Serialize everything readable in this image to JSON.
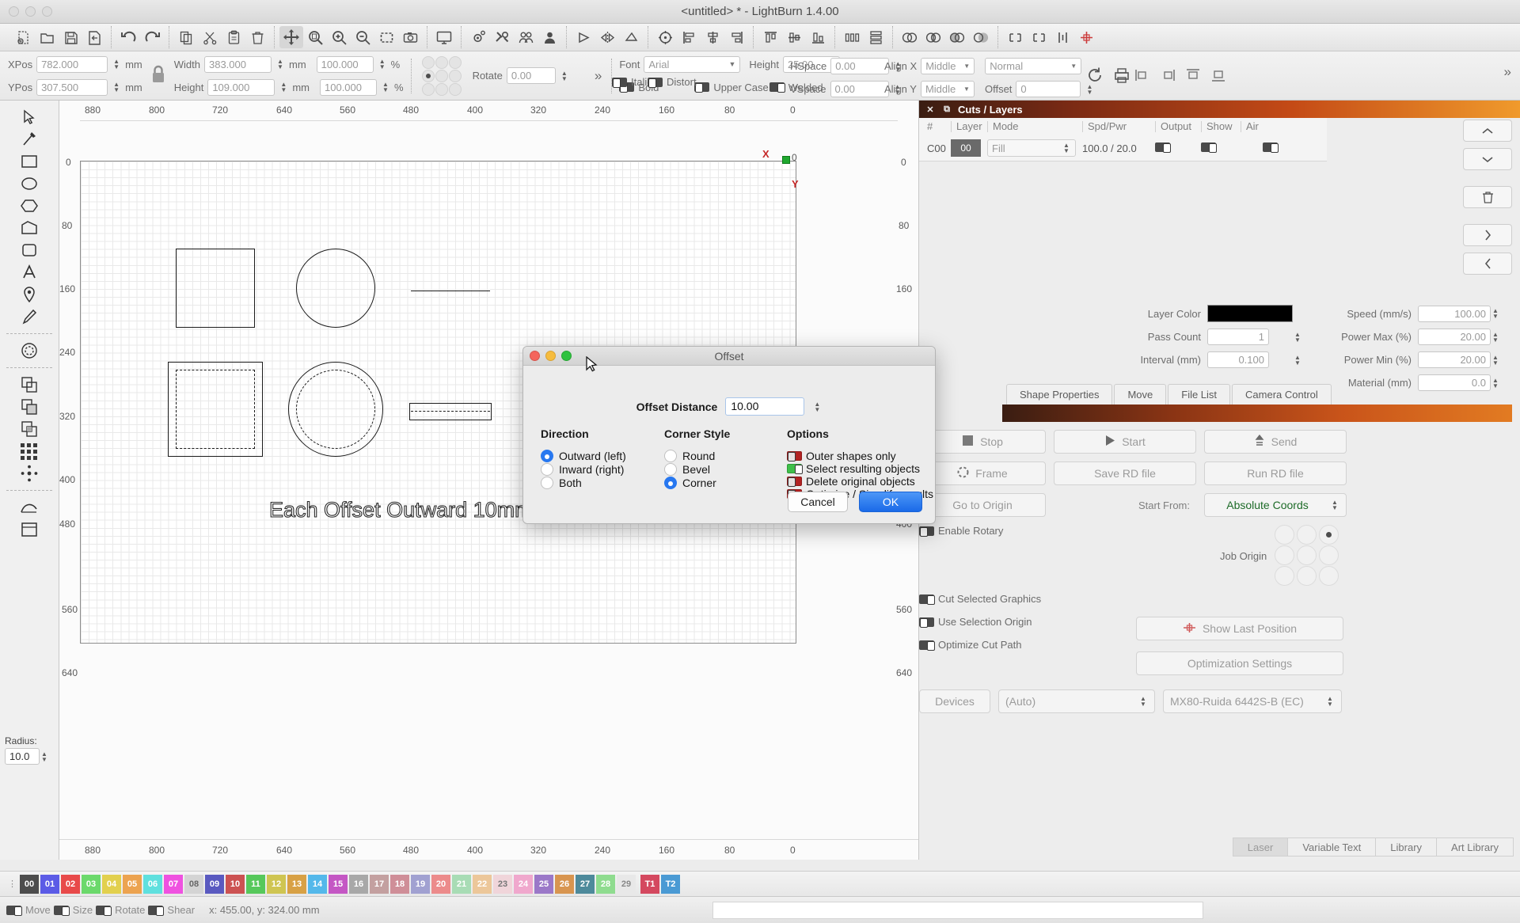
{
  "window": {
    "title": "<untitled> * - LightBurn 1.4.00"
  },
  "toolbar": {
    "groups": [
      {
        "buttons": [
          {
            "name": "new-file",
            "icon": "new-file-icon"
          },
          {
            "name": "open-file",
            "icon": "open-folder-icon"
          },
          {
            "name": "save-file",
            "icon": "save-disk-icon"
          },
          {
            "name": "export-file",
            "icon": "export-icon"
          }
        ]
      },
      {
        "buttons": [
          {
            "name": "undo",
            "icon": "undo-arrow-icon"
          },
          {
            "name": "redo",
            "icon": "redo-arrow-icon"
          }
        ]
      },
      {
        "buttons": [
          {
            "name": "copy",
            "icon": "copy-icon"
          },
          {
            "name": "cut",
            "icon": "scissors-icon"
          },
          {
            "name": "paste",
            "icon": "clipboard-icon"
          },
          {
            "name": "delete",
            "icon": "trash-icon"
          }
        ]
      },
      {
        "buttons": [
          {
            "name": "pan-tool",
            "icon": "move-arrows-icon",
            "selected": true
          },
          {
            "name": "zoom-fit",
            "icon": "zoom-page-icon"
          },
          {
            "name": "zoom-in",
            "icon": "zoom-in-icon"
          },
          {
            "name": "zoom-out",
            "icon": "zoom-out-icon"
          },
          {
            "name": "zoom-selection",
            "icon": "zoom-selection-icon"
          },
          {
            "name": "camera-capture",
            "icon": "camera-icon"
          }
        ]
      },
      {
        "buttons": [
          {
            "name": "preview",
            "icon": "monitor-icon"
          }
        ]
      },
      {
        "buttons": [
          {
            "name": "device-settings",
            "icon": "gear-icon"
          },
          {
            "name": "machine-settings",
            "icon": "wrench-icon"
          },
          {
            "name": "font-manager",
            "icon": "user-group-icon"
          },
          {
            "name": "user-icon",
            "icon": "user-icon"
          }
        ]
      },
      {
        "buttons": [
          {
            "name": "cut-direction",
            "icon": "arrow-right-icon"
          },
          {
            "name": "mirror-horizontal",
            "icon": "mirror-h-icon"
          },
          {
            "name": "mirror-vertical",
            "icon": "mirror-v-icon"
          }
        ]
      },
      {
        "buttons": [
          {
            "name": "rotate-tool",
            "icon": "rotate-icon"
          },
          {
            "name": "align-left",
            "icon": "align-left-icon"
          },
          {
            "name": "align-center-h",
            "icon": "align-center-icon"
          },
          {
            "name": "align-right",
            "icon": "align-right-icon"
          }
        ]
      },
      {
        "buttons": [
          {
            "name": "align-top",
            "icon": "align-top-icon"
          },
          {
            "name": "align-middle",
            "icon": "align-middle-icon"
          },
          {
            "name": "align-bottom",
            "icon": "align-bottom-icon"
          }
        ]
      },
      {
        "buttons": [
          {
            "name": "distribute-h",
            "icon": "distribute-h-icon"
          },
          {
            "name": "distribute-v",
            "icon": "distribute-v-icon"
          }
        ]
      },
      {
        "buttons": [
          {
            "name": "group-objects",
            "icon": "group-icon"
          },
          {
            "name": "ungroup-objects",
            "icon": "ungroup-icon"
          },
          {
            "name": "boolean-union",
            "icon": "union-icon"
          },
          {
            "name": "boolean-subtract",
            "icon": "subtract-icon"
          }
        ]
      },
      {
        "buttons": [
          {
            "name": "weld-shapes",
            "icon": "weld-icon"
          },
          {
            "name": "offset-shapes",
            "icon": "offset-icon"
          },
          {
            "name": "array-tool",
            "icon": "array-icon"
          },
          {
            "name": "center-origin",
            "icon": "crosshair-icon"
          }
        ]
      }
    ]
  },
  "properties": {
    "xpos_label": "XPos",
    "xpos_value": "782.000",
    "ypos_label": "YPos",
    "ypos_value": "307.500",
    "pos_unit": "mm",
    "width_label": "Width",
    "width_value": "383.000",
    "height_label": "Height",
    "height_value": "109.000",
    "size_unit": "mm",
    "width_pct": "100.000",
    "height_pct": "100.000",
    "pct_sign": "%",
    "rotate_label": "Rotate",
    "rotate_value": "0.00",
    "lock_icon": "lock-icon",
    "expand_icon": "chevron-double-right-icon"
  },
  "text_toolbar": {
    "font_label": "Font",
    "font_value": "Arial",
    "height_label": "Height",
    "height_value": "25.00",
    "hspace_label": "HSpace",
    "hspace_value": "0.00",
    "vspace_label": "VSpace",
    "vspace_value": "0.00",
    "alignx_label": "Align X",
    "alignx_value": "Middle",
    "aligny_label": "Align Y",
    "aligny_value": "Middle",
    "normal_value": "Normal",
    "offset_label": "Offset",
    "offset_value": "0",
    "toggles": [
      {
        "label": "Bold",
        "on": false
      },
      {
        "label": "Italic",
        "on": false
      },
      {
        "label": "Upper Case",
        "on": false
      },
      {
        "label": "Distort",
        "on": false
      },
      {
        "label": "Welded",
        "on": false
      }
    ],
    "right_icons": [
      {
        "name": "refresh-icon"
      },
      {
        "name": "print-icon"
      },
      {
        "name": "align-node-left-icon"
      },
      {
        "name": "align-node-right-icon"
      },
      {
        "name": "align-node-top-icon"
      },
      {
        "name": "align-node-bottom-icon"
      },
      {
        "name": "expand-panel-icon"
      }
    ]
  },
  "tools": [
    {
      "name": "select-tool",
      "icon": "arrow-cursor-icon"
    },
    {
      "name": "edit-nodes-tool",
      "icon": "node-edit-icon"
    },
    {
      "name": "rectangle-tool",
      "icon": "square-icon"
    },
    {
      "name": "ellipse-tool",
      "icon": "circle-icon"
    },
    {
      "name": "polygon-tool",
      "icon": "hexagon-icon"
    },
    {
      "name": "draw-lines-tool",
      "icon": "polyline-icon"
    },
    {
      "name": "rounded-rect-tool",
      "icon": "rounded-square-icon"
    },
    {
      "name": "text-tool",
      "icon": "letter-a-icon"
    },
    {
      "name": "position-tool",
      "icon": "map-pin-icon"
    },
    {
      "name": "pen-tool",
      "icon": "pencil-icon"
    },
    {
      "name": "offset-shapes-tool",
      "icon": "offset-ring-icon"
    },
    {
      "name": "boolean-union-tool",
      "icon": "bool-union-icon"
    },
    {
      "name": "boolean-subtract-tool",
      "icon": "bool-subtract-icon"
    },
    {
      "name": "boolean-intersect-tool",
      "icon": "bool-intersect-icon"
    },
    {
      "name": "grid-array-tool",
      "icon": "grid-array-icon"
    },
    {
      "name": "circular-array-tool",
      "icon": "circular-array-icon"
    },
    {
      "name": "trace-image-tool",
      "icon": "trace-curve-icon"
    },
    {
      "name": "print-and-cut-tool",
      "icon": "print-cut-icon"
    }
  ],
  "radius": {
    "label": "Radius:",
    "value": "10.0"
  },
  "canvas": {
    "ruler_top": [
      "880",
      "800",
      "720",
      "640",
      "560",
      "480",
      "400",
      "320",
      "240",
      "160",
      "80",
      "0"
    ],
    "ruler_bottom": [
      "880",
      "800",
      "720",
      "640",
      "560",
      "480",
      "400",
      "320",
      "240",
      "160",
      "80",
      "0"
    ],
    "ruler_left": [
      "0",
      "80",
      "160",
      "240",
      "320",
      "400",
      "480",
      "560",
      "640"
    ],
    "ruler_right": [
      "0",
      "80",
      "160",
      "240",
      "320",
      "400",
      "480",
      "560",
      "640"
    ],
    "annotation": "Each Offset Outward 10mm",
    "axis_x_label": "X",
    "axis_y_label": "Y",
    "origin_value": "0"
  },
  "cuts_panel": {
    "title": "Cuts / Layers",
    "close_icon": "close-icon",
    "float_icon": "float-window-icon",
    "columns": [
      "#",
      "Layer",
      "Mode",
      "Spd/Pwr",
      "Output",
      "Show",
      "Air"
    ],
    "rows": [
      {
        "num": "C00",
        "layer": "00",
        "mode": "Fill",
        "spd_pwr": "100.0 / 20.0",
        "output": true,
        "show": true,
        "air": true
      }
    ],
    "side_buttons": [
      {
        "name": "move-layer-up",
        "icon": "chevron-up-icon"
      },
      {
        "name": "move-layer-down",
        "icon": "chevron-down-icon"
      },
      {
        "name": "delete-layer",
        "icon": "trash-icon"
      },
      {
        "name": "next-layer",
        "icon": "chevron-right-icon"
      },
      {
        "name": "prev-layer",
        "icon": "chevron-left-icon"
      }
    ]
  },
  "layer_settings": {
    "layer_color_label": "Layer Color",
    "layer_color_value": "#000000",
    "pass_count_label": "Pass Count",
    "pass_count_value": "1",
    "interval_label": "Interval (mm)",
    "interval_value": "0.100",
    "speed_label": "Speed (mm/s)",
    "speed_value": "100.00",
    "power_max_label": "Power Max (%)",
    "power_max_value": "20.00",
    "power_min_label": "Power Min (%)",
    "power_min_value": "20.00",
    "material_label": "Material (mm)",
    "material_value": "0.0"
  },
  "panel_tabs": [
    "Shape Properties",
    "Move",
    "File List",
    "Camera Control"
  ],
  "laser_panel": {
    "buttons_row1": [
      {
        "label": "Stop",
        "icon": "stop-square-icon"
      },
      {
        "label": "Start",
        "icon": "play-triangle-icon"
      },
      {
        "label": "Send",
        "icon": "send-up-icon"
      }
    ],
    "buttons_row2": [
      {
        "label": "Frame",
        "icon": "frame-dashed-circle-icon"
      },
      {
        "label": "Save RD file",
        "icon": ""
      },
      {
        "label": "Run RD file",
        "icon": ""
      }
    ],
    "go_to_origin": "Go to Origin",
    "start_from_label": "Start From:",
    "start_from_value": "Absolute Coords",
    "job_origin_label": "Job Origin",
    "enable_rotary": {
      "label": "Enable Rotary",
      "on": false
    },
    "cut_selected_graphics": {
      "label": "Cut Selected Graphics",
      "on": false
    },
    "use_selection_origin": {
      "label": "Use Selection Origin",
      "on": false
    },
    "optimize_cut_path": {
      "label": "Optimize Cut Path",
      "on": false
    },
    "show_last_position": "Show Last Position",
    "optimization_settings": "Optimization Settings",
    "devices_label": "Devices",
    "device_auto": "(Auto)",
    "device_name": "MX80-Ruida 6442S-B (EC)"
  },
  "bottom_tabs": [
    {
      "label": "Laser",
      "active": true
    },
    {
      "label": "Variable Text",
      "active": false
    },
    {
      "label": "Library",
      "active": false
    },
    {
      "label": "Art Library",
      "active": false
    }
  ],
  "palette": {
    "swatches": [
      {
        "id": "00",
        "color": "#4d4d4d"
      },
      {
        "id": "01",
        "color": "#5b5be6"
      },
      {
        "id": "02",
        "color": "#e84a4a"
      },
      {
        "id": "03",
        "color": "#6bd96b"
      },
      {
        "id": "04",
        "color": "#e2d04e"
      },
      {
        "id": "05",
        "color": "#eca350"
      },
      {
        "id": "06",
        "color": "#5fe0de"
      },
      {
        "id": "07",
        "color": "#ef52e0"
      },
      {
        "id": "08",
        "color": "#d4d4d4"
      },
      {
        "id": "09",
        "color": "#5a5ac0"
      },
      {
        "id": "10",
        "color": "#cc5252"
      },
      {
        "id": "11",
        "color": "#56c85b"
      },
      {
        "id": "12",
        "color": "#cfc552"
      },
      {
        "id": "13",
        "color": "#d8a145"
      },
      {
        "id": "14",
        "color": "#54b8ea"
      },
      {
        "id": "15",
        "color": "#c457c4"
      },
      {
        "id": "16",
        "color": "#a8a8a8"
      },
      {
        "id": "17",
        "color": "#c3a0a0"
      },
      {
        "id": "18",
        "color": "#cf8e98"
      },
      {
        "id": "19",
        "color": "#a1a1d1"
      },
      {
        "id": "20",
        "color": "#ec8b8b"
      },
      {
        "id": "21",
        "color": "#a8dcb5"
      },
      {
        "id": "22",
        "color": "#ecc79a"
      },
      {
        "id": "23",
        "color": "#f0d5da"
      },
      {
        "id": "24",
        "color": "#f0a8cd"
      },
      {
        "id": "25",
        "color": "#9b78c8"
      },
      {
        "id": "26",
        "color": "#d89550"
      },
      {
        "id": "27",
        "color": "#4e8a9b"
      },
      {
        "id": "28",
        "color": "#8fdc8f"
      },
      {
        "id": "29",
        "color": "#e8e8e8"
      },
      {
        "id": "T1",
        "color": "#d4485f"
      },
      {
        "id": "T2",
        "color": "#4a9ad4"
      }
    ]
  },
  "statusbar": {
    "toggles": [
      {
        "label": "Move",
        "on": false
      },
      {
        "label": "Size",
        "on": false
      },
      {
        "label": "Rotate",
        "on": false
      },
      {
        "label": "Shear",
        "on": false
      }
    ],
    "coords": "x: 455.00, y: 324.00 mm"
  },
  "dialog": {
    "title": "Offset",
    "offset_distance_label": "Offset Distance",
    "offset_distance_value": "10.00",
    "direction_title": "Direction",
    "direction_options": [
      {
        "label": "Outward (left)",
        "selected": true
      },
      {
        "label": "Inward (right)",
        "selected": false
      },
      {
        "label": "Both",
        "selected": false
      }
    ],
    "corner_style_title": "Corner Style",
    "corner_options": [
      {
        "label": "Round",
        "selected": false
      },
      {
        "label": "Bevel",
        "selected": false
      },
      {
        "label": "Corner",
        "selected": true
      }
    ],
    "options_title": "Options",
    "option_toggles": [
      {
        "label": "Outer shapes only",
        "on": false
      },
      {
        "label": "Select resulting objects",
        "on": true
      },
      {
        "label": "Delete original objects",
        "on": false
      },
      {
        "label": "Optimize / Simplify results",
        "on": false
      }
    ],
    "cancel_label": "Cancel",
    "ok_label": "OK"
  }
}
